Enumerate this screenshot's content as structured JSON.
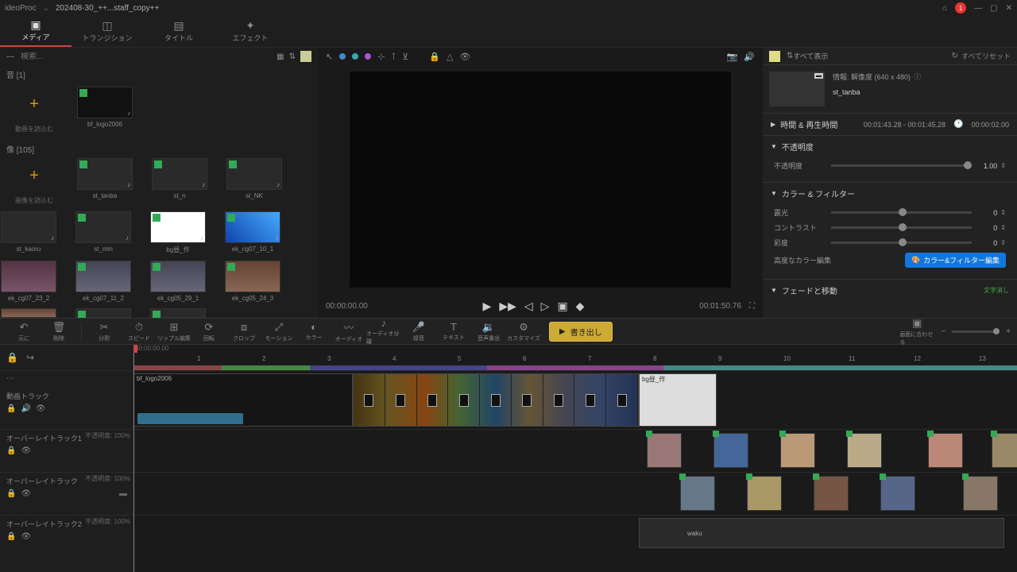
{
  "title_bar": {
    "app": "ideoProc",
    "project": "202408-30_++...staff_copy++",
    "notif_count": "1"
  },
  "tabs": [
    {
      "label": "メディア",
      "icon": "▣"
    },
    {
      "label": "トランジション",
      "icon": "◫"
    },
    {
      "label": "タイトル",
      "icon": "▤"
    },
    {
      "label": "エフェクト",
      "icon": "✦"
    }
  ],
  "search": {
    "placeholder": "検索..."
  },
  "media": {
    "cat_audio": "音 [1]",
    "add_audio": "動画を読込む",
    "cat_image": "像 [105]",
    "add_image": "画像を読込む",
    "items_audio": [
      {
        "name": "bf_logo2006"
      }
    ],
    "items_image": [
      {
        "name": "st_tanba"
      },
      {
        "name": "st_n"
      },
      {
        "name": "st_NK"
      },
      {
        "name": "st_kaoru"
      },
      {
        "name": "st_min"
      },
      {
        "name": "bg昼_作"
      },
      {
        "name": "ek_cg07_10_1"
      },
      {
        "name": "ek_cg07_23_2"
      },
      {
        "name": "ek_cg07_11_2"
      },
      {
        "name": "ek_cg05_29_1"
      },
      {
        "name": "ek_cg05_24_3"
      }
    ]
  },
  "preview": {
    "time_left": "00:00:00.00",
    "time_right": "00:01:50.76"
  },
  "inspector": {
    "show_all": "すべて表示",
    "reset_all": "すべてリセット",
    "info": "情報: 解像度 (640 x 480)",
    "clip_name": "st_tanba",
    "sec_time": "時間 & 再生時間",
    "time_range": "00:01:43.28 - 00:01:45.28",
    "duration": "00:00:02.00",
    "sec_opacity": "不透明度",
    "opacity_val": "1.00",
    "sec_color": "カラー & フィルター",
    "exposure": "露光",
    "contrast": "コントラスト",
    "saturation": "彩度",
    "adv_color": "高度なカラー編集",
    "color_btn": "カラー&フィルター編集",
    "sec_fade": "フェードと移動"
  },
  "toolbar": {
    "undo": "元に",
    "delete": "削除",
    "cut": "分割",
    "speed": "スピード",
    "ripple": "リップル編集",
    "rotate": "回転",
    "crop": "クロップ",
    "motion": "モーション",
    "color": "カラー",
    "audio_fade": "オーディオ",
    "audio_sep": "オーディオ分離",
    "record": "録音",
    "text": "テキスト",
    "audio_out": "音声書出",
    "customize": "カスタマイズ",
    "export": "書き出し",
    "fit": "画面に合わせる",
    "applied": "文字消し"
  },
  "timeline": {
    "start": "00:00:00.00",
    "default_time": "00:01:50.76",
    "markers": [
      "0",
      "1",
      "2",
      "3",
      "4",
      "5",
      "6",
      "7",
      "8",
      "9",
      "10",
      "11",
      "12",
      "13"
    ],
    "track1": "動画トラック",
    "track2": "オーバーレイトラック1",
    "track3": "オーバーレイトラック",
    "track4": "オーバーレイトラック2",
    "opacity_label": "不透明度: 100%",
    "clip1": "bf_logo2006",
    "clip_bg": "bg昼_作",
    "clip_waku": "waku"
  }
}
